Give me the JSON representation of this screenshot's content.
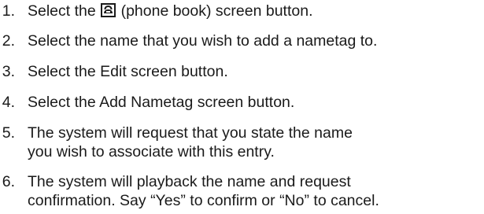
{
  "steps": [
    {
      "num": "1.",
      "lines": [
        "Select the",
        "(phone book) screen button."
      ],
      "icon": "phonebook-icon"
    },
    {
      "num": "2.",
      "lines": [
        "Select the name that you wish to add a nametag to."
      ]
    },
    {
      "num": "3.",
      "lines": [
        "Select the Edit screen button."
      ]
    },
    {
      "num": "4.",
      "lines": [
        "Select the Add Nametag screen button."
      ]
    },
    {
      "num": "5.",
      "lines": [
        "The system will request that you state the name",
        "you wish to associate with this entry."
      ]
    },
    {
      "num": "6.",
      "lines": [
        "The system will playback the name and request",
        "confirmation. Say “Yes” to confirm or “No” to cancel."
      ]
    }
  ]
}
